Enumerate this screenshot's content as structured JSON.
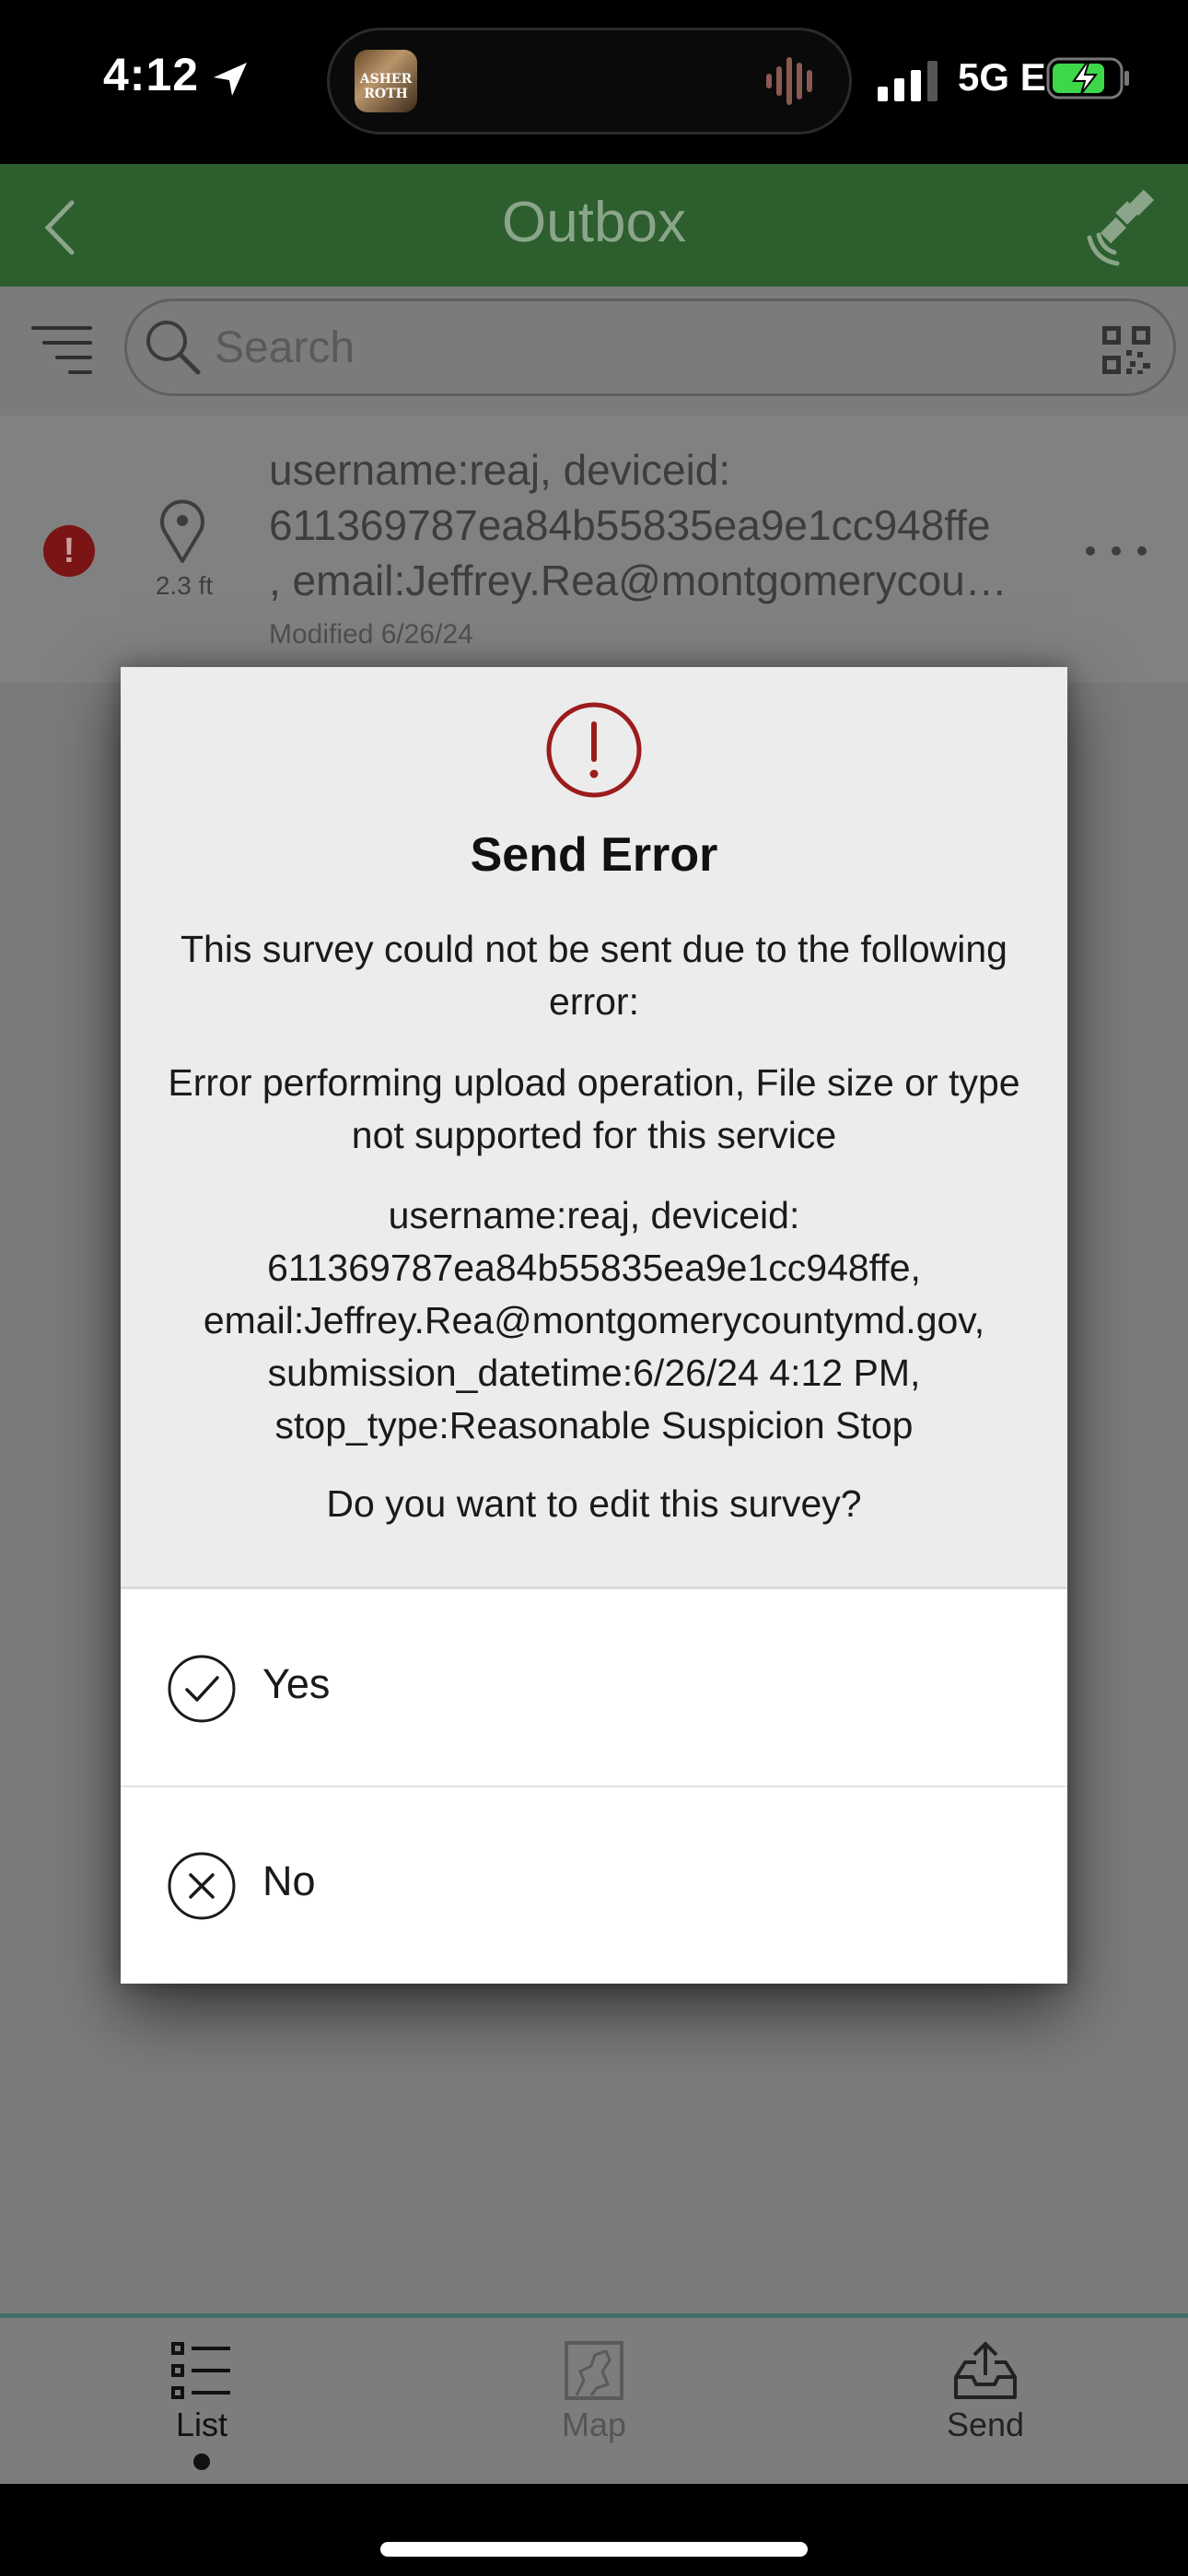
{
  "status_bar": {
    "time": "4:12",
    "island_art_text": "ASHER ROTH",
    "network": "5G E"
  },
  "header": {
    "title": "Outbox"
  },
  "search": {
    "placeholder": "Search"
  },
  "list": {
    "items": [
      {
        "title_lines": [
          "username:reaj, deviceid:",
          "611369787ea84b55835ea9e1cc948ffe",
          ", email:Jeffrey.Rea@montgomerycou…"
        ],
        "distance": "2.3 ft",
        "modified": "Modified 6/26/24",
        "status_icon": "!"
      }
    ]
  },
  "dialog": {
    "alert_icon": "!",
    "title": "Send Error",
    "message": "This survey could not be sent due to the following error:",
    "error": "Error performing upload operation, File size or type not supported for this service",
    "details_lines": [
      "username:reaj, deviceid:",
      "611369787ea84b55835ea9e1cc948ffe,",
      "email:Jeffrey.Rea@montgomerycountymd.gov,",
      "submission_datetime:6/26/24 4:12 PM,",
      "stop_type:Reasonable Suspicion Stop"
    ],
    "question": "Do you want to edit this survey?",
    "options": [
      {
        "label": "Yes",
        "icon": "check-circle-icon"
      },
      {
        "label": "No",
        "icon": "x-circle-icon"
      }
    ]
  },
  "tabs": [
    {
      "label": "List",
      "icon": "list-icon",
      "active": true
    },
    {
      "label": "Map",
      "icon": "map-icon",
      "active": false
    },
    {
      "label": "Send",
      "icon": "send-tray-icon",
      "active": false
    }
  ],
  "colors": {
    "header_green": "#2c5e2e",
    "error_red": "#9b1c1c",
    "overlay_gray": "#7b7b7b"
  }
}
